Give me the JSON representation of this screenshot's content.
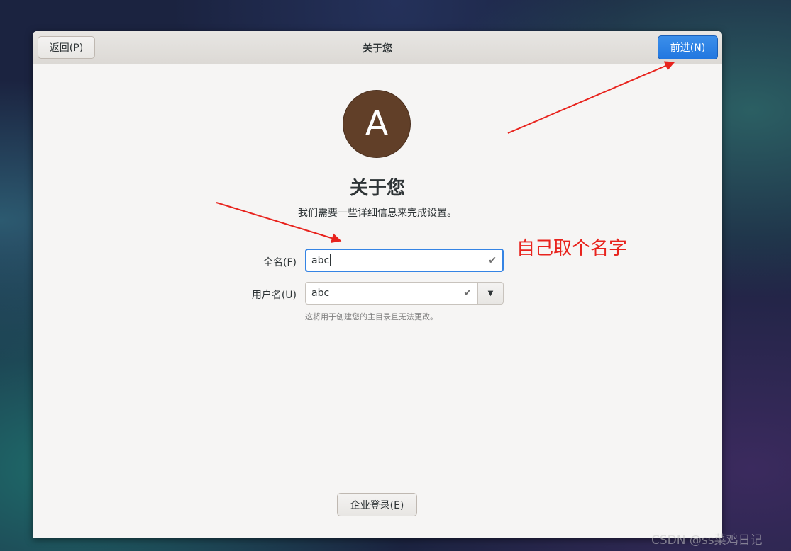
{
  "window": {
    "title": "关于您",
    "back_label": "返回(P)",
    "next_label": "前进(N)"
  },
  "avatar": {
    "initial": "A",
    "color": "#613f28"
  },
  "main": {
    "heading": "关于您",
    "subtitle": "我们需要一些详细信息来完成设置。"
  },
  "form": {
    "fullname_label": "全名(F)",
    "fullname_value": "abc",
    "username_label": "用户名(U)",
    "username_value": "abc",
    "username_hint": "这将用于创建您的主目录且无法更改。"
  },
  "footer": {
    "enterprise_label": "企业登录(E)"
  },
  "annotation": {
    "text": "自己取个名字",
    "color": "#e8231d"
  },
  "watermark": {
    "text": "CSDN @ss菜鸡日记"
  },
  "colors": {
    "accent": "#3584e4",
    "window_bg": "#f6f5f4"
  }
}
